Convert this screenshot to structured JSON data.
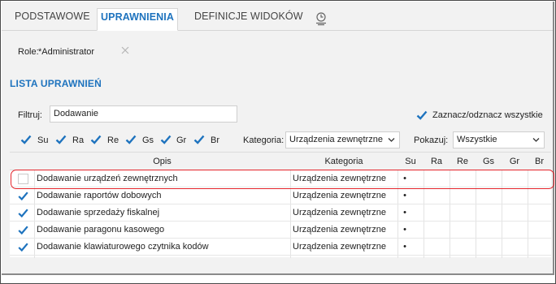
{
  "tabs": [
    {
      "label": "PODSTAWOWE",
      "active": false
    },
    {
      "label": "UPRAWNIENIA",
      "active": true
    },
    {
      "label": "DEFINICJE WIDOKÓW",
      "active": false
    }
  ],
  "role": {
    "label": "Role:",
    "value": "*Administrator"
  },
  "section_title": "LISTA UPRAWNIEŃ",
  "filter": {
    "label": "Filtruj:",
    "value": "Dodawanie"
  },
  "select_all": {
    "label": "Zaznacz/odznacz wszystkie",
    "checked": true
  },
  "column_toggles": [
    {
      "label": "Su",
      "checked": true
    },
    {
      "label": "Ra",
      "checked": true
    },
    {
      "label": "Re",
      "checked": true
    },
    {
      "label": "Gs",
      "checked": true
    },
    {
      "label": "Gr",
      "checked": true
    },
    {
      "label": "Br",
      "checked": true
    }
  ],
  "category_filter": {
    "label": "Kategoria:",
    "value": "Urządzenia zewnętrzne"
  },
  "show_filter": {
    "label": "Pokazuj:",
    "value": "Wszystkie"
  },
  "table": {
    "headers": {
      "opis": "Opis",
      "kategoria": "Kategoria",
      "cols": [
        "Su",
        "Ra",
        "Re",
        "Gs",
        "Gr",
        "Br"
      ]
    },
    "rows": [
      {
        "checked": false,
        "opis": "Dodawanie urządzeń zewnętrznych",
        "kategoria": "Urządzenia zewnętrzne",
        "su": "•",
        "highlighted": true
      },
      {
        "checked": true,
        "opis": "Dodawanie raportów dobowych",
        "kategoria": "Urządzenia zewnętrzne",
        "su": "•"
      },
      {
        "checked": true,
        "opis": "Dodawanie sprzedaży fiskalnej",
        "kategoria": "Urządzenia zewnętrzne",
        "su": "•"
      },
      {
        "checked": true,
        "opis": "Dodawanie paragonu kasowego",
        "kategoria": "Urządzenia zewnętrzne",
        "su": "•"
      },
      {
        "checked": true,
        "opis": "Dodawanie klawiaturowego czytnika kodów",
        "kategoria": "Urządzenia zewnętrzne",
        "su": "•"
      }
    ]
  },
  "colors": {
    "accent": "#1e73be",
    "highlight": "#e5242b"
  }
}
